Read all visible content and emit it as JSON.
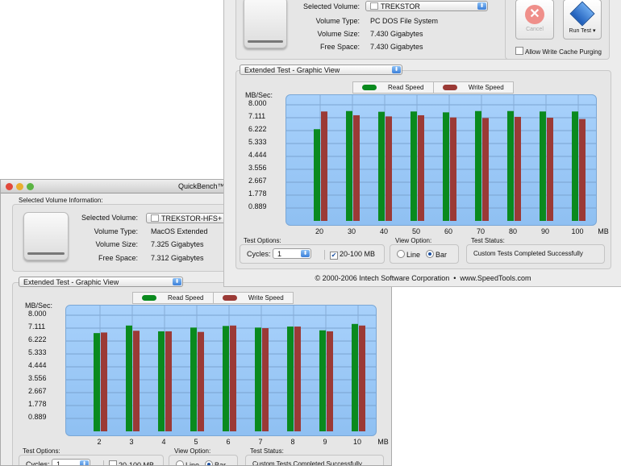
{
  "colors": {
    "read": "#0a8a1e",
    "write": "#9b3a36",
    "chart_bg": "#9ccaf7"
  },
  "back_window": {
    "title": "QuickBench™",
    "volume_info_label": "Selected Volume Information:",
    "selected_volume_label": "Selected Volume:",
    "selected_volume": "TREKSTOR-HFS+",
    "volume_type_label": "Volume Type:",
    "volume_type": "MacOS Extended",
    "volume_size_label": "Volume Size:",
    "volume_size": "7.325 Gigabytes",
    "free_space_label": "Free Space:",
    "free_space": "7.312 Gigabytes",
    "view_mode": "Extended Test - Graphic View",
    "test_options_label": "Test Options:",
    "cycles_label": "Cycles:",
    "cycles": "1",
    "range_label": "20-100 MB",
    "range_checked": false,
    "view_option_label": "View Option:",
    "line_label": "Line",
    "bar_label": "Bar",
    "test_status_label": "Test Status:",
    "test_status": "Custom Tests Completed Successfully"
  },
  "front_window": {
    "selected_volume_label": "Selected Volume:",
    "selected_volume": "TREKSTOR",
    "volume_type_label": "Volume Type:",
    "volume_type": "PC DOS File System",
    "volume_size_label": "Volume Size:",
    "volume_size": "7.430 Gigabytes",
    "free_space_label": "Free Space:",
    "free_space": "7.430 Gigabytes",
    "cancel_label": "Cancel",
    "run_test_label": "Run Test",
    "write_cache_label": "Allow Write Cache Purging",
    "view_mode": "Extended Test - Graphic View",
    "test_options_label": "Test Options:",
    "cycles_label": "Cycles:",
    "cycles": "1",
    "range_label": "20-100 MB",
    "range_checked": true,
    "view_option_label": "View Option:",
    "line_label": "Line",
    "bar_label": "Bar",
    "test_status_label": "Test Status:",
    "test_status": "Custom Tests Completed Successfully",
    "copyright": "© 2000-2006 Intech Software Corporation  •  www.SpeedTools.com"
  },
  "chart_data": [
    {
      "type": "bar",
      "window": "front",
      "ylabel": "MB/Sec:",
      "xunit": "MB",
      "ylim": [
        0,
        8
      ],
      "yticks": [
        "8.000",
        "7.111",
        "6.222",
        "5.333",
        "4.444",
        "3.556",
        "2.667",
        "1.778",
        "0.889"
      ],
      "categories": [
        "20",
        "30",
        "40",
        "50",
        "60",
        "70",
        "80",
        "90",
        "100"
      ],
      "series": [
        {
          "name": "Read Speed",
          "values": [
            6.32,
            7.57,
            7.52,
            7.54,
            7.48,
            7.57,
            7.57,
            7.54,
            7.54
          ]
        },
        {
          "name": "Write Speed",
          "values": [
            7.54,
            7.28,
            7.2,
            7.28,
            7.13,
            7.09,
            7.17,
            7.11,
            7.02
          ]
        }
      ]
    },
    {
      "type": "bar",
      "window": "back",
      "ylabel": "MB/Sec:",
      "xunit": "MB",
      "ylim": [
        0,
        8
      ],
      "yticks": [
        "8.000",
        "7.111",
        "6.222",
        "5.333",
        "4.444",
        "3.556",
        "2.667",
        "1.778",
        "0.889"
      ],
      "categories": [
        "2",
        "3",
        "4",
        "5",
        "6",
        "7",
        "8",
        "9",
        "10"
      ],
      "series": [
        {
          "name": "Read Speed",
          "values": [
            6.77,
            7.29,
            6.89,
            7.15,
            7.26,
            7.15,
            7.22,
            6.96,
            7.4
          ]
        },
        {
          "name": "Write Speed",
          "values": [
            6.81,
            6.93,
            6.89,
            6.85,
            7.29,
            7.11,
            7.22,
            6.89,
            7.29
          ]
        }
      ]
    }
  ]
}
